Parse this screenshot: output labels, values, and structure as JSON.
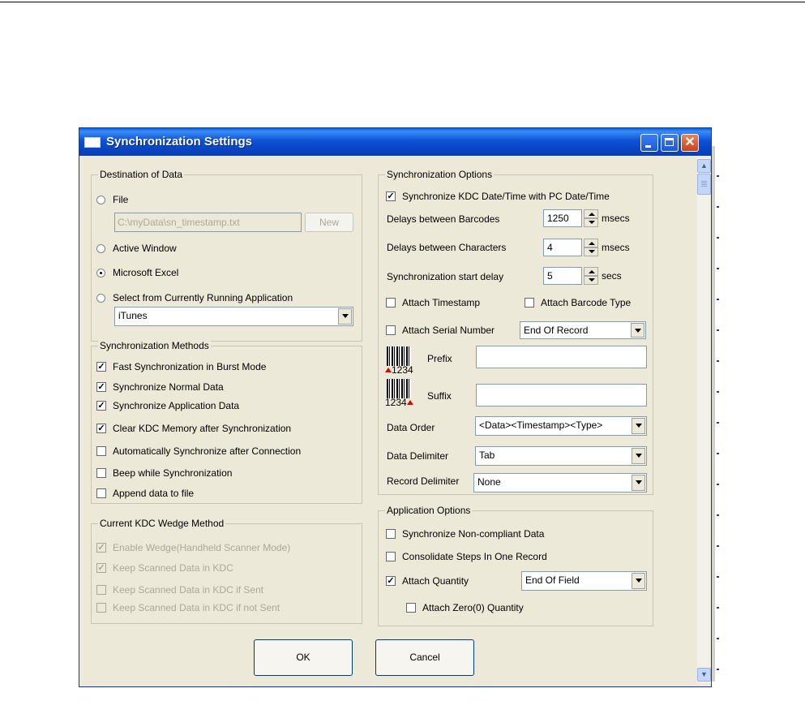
{
  "window": {
    "title": "Synchronization Settings"
  },
  "destination": {
    "legend": "Destination of Data",
    "file_label": "File",
    "file_path": "C:\\myData\\sn_timestamp.txt",
    "new_button": "New",
    "active_window_label": "Active Window",
    "excel_label": "Microsoft Excel",
    "running_app_label": "Select from Currently Running Application",
    "running_app_value": "iTunes",
    "selected": "Microsoft Excel"
  },
  "methods": {
    "legend": "Synchronization Methods",
    "items": [
      {
        "label": "Fast Synchronization in Burst Mode",
        "checked": true
      },
      {
        "label": "Synchronize Normal Data",
        "checked": true
      },
      {
        "label": "Synchronize Application Data",
        "checked": true
      },
      {
        "label": "Clear KDC Memory after Synchronization",
        "checked": true
      },
      {
        "label": "Automatically Synchronize after Connection",
        "checked": false
      },
      {
        "label": "Beep while Synchronization",
        "checked": false
      },
      {
        "label": "Append data to file",
        "checked": false
      }
    ]
  },
  "wedge": {
    "legend": "Current KDC Wedge Method",
    "items": [
      {
        "label": "Enable Wedge(Handheld Scanner Mode)",
        "checked": true
      },
      {
        "label": "Keep Scanned Data in KDC",
        "checked": true
      },
      {
        "label": "Keep Scanned Data in KDC if Sent",
        "checked": false
      },
      {
        "label": "Keep Scanned Data in KDC if not Sent",
        "checked": false
      }
    ]
  },
  "sync_options": {
    "legend": "Synchronization Options",
    "sync_datetime_label": "Synchronize KDC Date/Time with PC Date/Time",
    "sync_datetime_checked": true,
    "delay_barcodes_label": "Delays between Barcodes",
    "delay_barcodes_value": "1250",
    "delay_barcodes_unit": "msecs",
    "delay_chars_label": "Delays between Characters",
    "delay_chars_value": "4",
    "delay_chars_unit": "msecs",
    "start_delay_label": "Synchronization start delay",
    "start_delay_value": "5",
    "start_delay_unit": "secs",
    "attach_timestamp_label": "Attach Timestamp",
    "attach_barcode_type_label": "Attach Barcode Type",
    "attach_serial_label": "Attach Serial Number",
    "serial_position": "End Of Record",
    "prefix_barcode": "1234",
    "prefix_label": "Prefix",
    "prefix_value": "",
    "suffix_barcode": "1234",
    "suffix_label": "Suffix",
    "suffix_value": "",
    "data_order_label": "Data Order",
    "data_order_value": "<Data><Timestamp><Type>",
    "data_delimiter_label": "Data Delimiter",
    "data_delimiter_value": "Tab",
    "record_delimiter_label": "Record Delimiter",
    "record_delimiter_value": "None"
  },
  "app_options": {
    "legend": "Application Options",
    "noncompliant_label": "Synchronize Non-compliant Data",
    "consolidate_label": "Consolidate Steps In One Record",
    "attach_quantity_label": "Attach Quantity",
    "attach_quantity_checked": true,
    "quantity_position": "End Of Field",
    "attach_zero_label": "Attach Zero(0) Quantity"
  },
  "buttons": {
    "ok": "OK",
    "cancel": "Cancel"
  },
  "colors": {
    "titlebar": "#0a4fd2",
    "dialog_bg": "#ece9d8",
    "close_button": "#d8512a",
    "prefix_arrow": "#e00000"
  }
}
